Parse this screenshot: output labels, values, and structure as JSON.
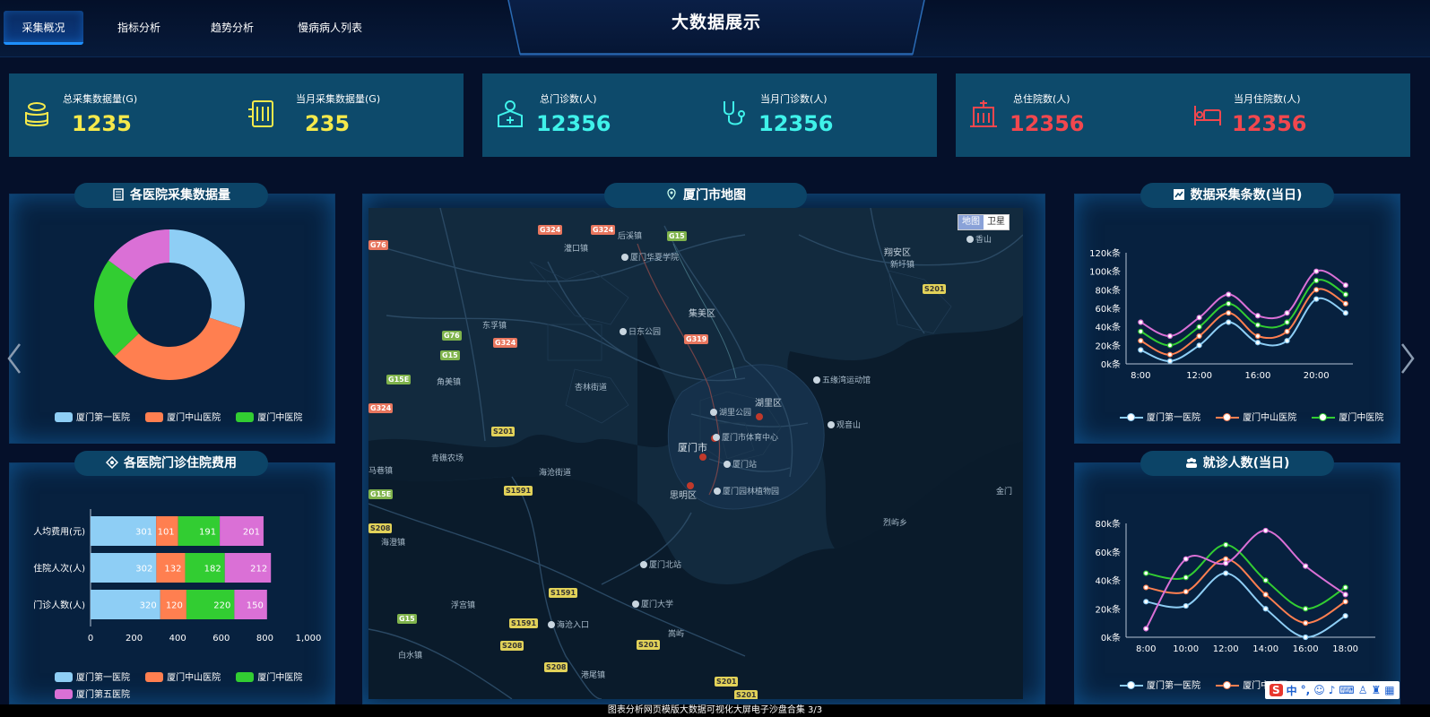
{
  "nav": {
    "tabs": [
      {
        "label": "采集概况"
      },
      {
        "label": "指标分析"
      },
      {
        "label": "趋势分析"
      },
      {
        "label": "慢病病人列表"
      }
    ]
  },
  "header": {
    "title": "大数据展示"
  },
  "stats": {
    "total_collect": {
      "label": "总采集数据量(G)",
      "value": "1235",
      "icon": "database-coins-icon"
    },
    "month_collect": {
      "label": "当月采集数据量(G)",
      "value": "235",
      "icon": "server-rack-icon"
    },
    "total_outpatient": {
      "label": "总门诊数(人)",
      "value": "12356",
      "icon": "clinic-person-icon"
    },
    "month_outpatient": {
      "label": "当月门诊数(人)",
      "value": "12356",
      "icon": "stethoscope-icon"
    },
    "total_inpatient": {
      "label": "总住院数(人)",
      "value": "12356",
      "icon": "hospital-building-icon"
    },
    "month_inpatient": {
      "label": "当月住院数(人)",
      "value": "12356",
      "icon": "hospital-bed-icon"
    }
  },
  "colors": {
    "yellow": "#f5e94b",
    "cyan": "#3ff2ea",
    "red": "#f2474e",
    "series1": "#8ecef5",
    "series2": "#ff7f50",
    "series3": "#32cd32",
    "series4": "#da70d6"
  },
  "panels": {
    "hospital_collect": {
      "title": "各医院采集数据量"
    },
    "hospital_fee": {
      "title": "各医院门诊住院费用"
    },
    "map": {
      "title": "厦门市地图",
      "switch_map": "地图",
      "switch_satellite": "卫星"
    },
    "collect_count": {
      "title": "数据采集条数(当日)"
    },
    "visit_count": {
      "title": "就诊人数(当日)"
    }
  },
  "map_labels": {
    "districts": [
      "翔安区",
      "集美区",
      "湖里区",
      "厦门市",
      "思明区",
      "海沧街道",
      "新圩镇",
      "马巷镇"
    ],
    "places": [
      "香山",
      "厦门华夏学院",
      "灌口镇",
      "后溪镇",
      "东孚镇",
      "日东公园",
      "杏林街道",
      "五缘湾运动馆",
      "观音山",
      "湖里公园",
      "厦门市体育中心",
      "厦门站",
      "厦门园林植物园",
      "青礁农场",
      "角美镇",
      "海澄镇",
      "浮宫镇",
      "海沧入口",
      "厦门大学",
      "嵩屿",
      "港尾镇",
      "白水镇",
      "烈屿乡",
      "金门",
      "厦门北站",
      "杏林",
      "后溪",
      "新店镇"
    ],
    "roads": [
      "G324",
      "G324",
      "G15",
      "G76",
      "G15",
      "G324",
      "G319",
      "G15E",
      "G324",
      "S201",
      "S201",
      "S1591",
      "G15E",
      "S208",
      "S1591",
      "S1591",
      "G15",
      "S208",
      "S208",
      "S201",
      "S201",
      "S201",
      "G76"
    ]
  },
  "chart_data": [
    {
      "type": "pie",
      "title": "各医院采集数据量",
      "categories": [
        "厦门第一医院",
        "厦门中山医院",
        "厦门中医院",
        "厦门第五医院"
      ],
      "values": [
        30,
        33,
        22,
        15
      ],
      "colors": [
        "#8ecef5",
        "#ff7f50",
        "#32cd32",
        "#da70d6"
      ],
      "legend": [
        "厦门第一医院",
        "厦门中山医院",
        "厦门中医院"
      ],
      "legend_position": "bottom"
    },
    {
      "type": "bar",
      "orientation": "horizontal",
      "stacked": true,
      "title": "各医院门诊住院费用",
      "categories": [
        "人均费用(元)",
        "住院人次(人)",
        "门诊人数(人)"
      ],
      "series": [
        {
          "name": "厦门第一医院",
          "values": [
            301,
            302,
            320
          ],
          "color": "#8ecef5"
        },
        {
          "name": "厦门中山医院",
          "values": [
            101,
            132,
            120
          ],
          "color": "#ff7f50"
        },
        {
          "name": "厦门中医院",
          "values": [
            191,
            182,
            220
          ],
          "color": "#32cd32"
        },
        {
          "name": "厦门第五医院",
          "values": [
            201,
            212,
            150
          ],
          "color": "#da70d6"
        }
      ],
      "xlim": [
        0,
        1000
      ],
      "xticks": [
        "0",
        "200",
        "400",
        "600",
        "800",
        "1,000"
      ],
      "legend_position": "bottom"
    },
    {
      "type": "line",
      "smooth": true,
      "title": "数据采集条数(当日)",
      "x": [
        7,
        8,
        9,
        10,
        11,
        12,
        13,
        14,
        15,
        16,
        17,
        18,
        19,
        20,
        21,
        22
      ],
      "xticks": [
        "8:00",
        "12:00",
        "16:00",
        "20:00"
      ],
      "ylim": [
        0,
        120
      ],
      "yticks": [
        "0k条",
        "20k条",
        "40k条",
        "60k条",
        "80k条",
        "100k条",
        "120k条"
      ],
      "series": [
        {
          "name": "厦门第一医院",
          "values": [
            15,
            3,
            20,
            45,
            23,
            25,
            70,
            55
          ],
          "x": [
            8,
            10,
            12,
            14,
            16,
            18,
            20,
            22
          ],
          "color": "#8ecef5"
        },
        {
          "name": "厦门中山医院",
          "values": [
            25,
            10,
            30,
            55,
            30,
            35,
            80,
            65
          ],
          "x": [
            8,
            10,
            12,
            14,
            16,
            18,
            20,
            22
          ],
          "color": "#ff7f50"
        },
        {
          "name": "厦门中医院",
          "values": [
            35,
            20,
            40,
            65,
            42,
            45,
            90,
            75
          ],
          "x": [
            8,
            10,
            12,
            14,
            16,
            18,
            20,
            22
          ],
          "color": "#32cd32"
        },
        {
          "name": "",
          "values": [
            45,
            30,
            50,
            75,
            52,
            55,
            100,
            85
          ],
          "x": [
            8,
            10,
            12,
            14,
            16,
            18,
            20,
            22
          ],
          "color": "#da70d6"
        }
      ],
      "legend": [
        "厦门第一医院",
        "厦门中山医院",
        "厦门中医院"
      ]
    },
    {
      "type": "line",
      "smooth": true,
      "title": "就诊人数(当日)",
      "x": [
        8,
        10,
        12,
        14,
        16,
        18
      ],
      "xticks": [
        "8:00",
        "10:00",
        "12:00",
        "14:00",
        "16:00",
        "18:00"
      ],
      "ylim": [
        0,
        80
      ],
      "yticks": [
        "0k条",
        "20k条",
        "40k条",
        "60k条",
        "80k条"
      ],
      "series": [
        {
          "name": "厦门第一医院",
          "values": [
            25,
            22,
            45,
            20,
            0,
            15
          ],
          "color": "#8ecef5"
        },
        {
          "name": "厦门中山医院",
          "values": [
            35,
            32,
            55,
            30,
            10,
            25
          ],
          "color": "#ff7f50"
        },
        {
          "name": "厦门中医院",
          "values": [
            45,
            42,
            65,
            40,
            20,
            35
          ],
          "color": "#32cd32"
        },
        {
          "name": "",
          "values": [
            6,
            55,
            52,
            75,
            50,
            30
          ],
          "color": "#da70d6"
        }
      ],
      "legend": [
        "厦门第一医院",
        "厦门中山医"
      ]
    }
  ],
  "footer": {
    "caption": "图表分析网页模版大数据可视化大屏电子沙盘合集   3/3"
  },
  "ime": {
    "logo": "S",
    "mode": "中"
  }
}
